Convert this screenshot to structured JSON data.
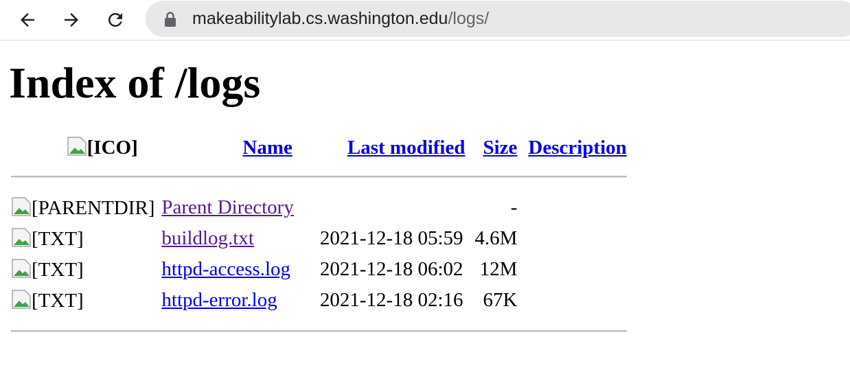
{
  "browser": {
    "url_host": "makeabilitylab.cs.washington.edu",
    "url_path": "/logs/"
  },
  "page": {
    "heading": "Index of /logs",
    "columns": {
      "icon": "[ICO]",
      "name": "Name",
      "last_modified": "Last modified",
      "size": "Size",
      "description": "Description"
    },
    "rows": [
      {
        "icon_alt": "[PARENTDIR]",
        "name": "Parent Directory",
        "date": "",
        "size": "-",
        "visited": true
      },
      {
        "icon_alt": "[TXT]",
        "name": "buildlog.txt",
        "date": "2021-12-18 05:59",
        "size": "4.6M",
        "visited": true
      },
      {
        "icon_alt": "[TXT]",
        "name": "httpd-access.log",
        "date": "2021-12-18 06:02",
        "size": "12M",
        "visited": false
      },
      {
        "icon_alt": "[TXT]",
        "name": "httpd-error.log",
        "date": "2021-12-18 02:16",
        "size": "67K",
        "visited": false
      }
    ]
  }
}
